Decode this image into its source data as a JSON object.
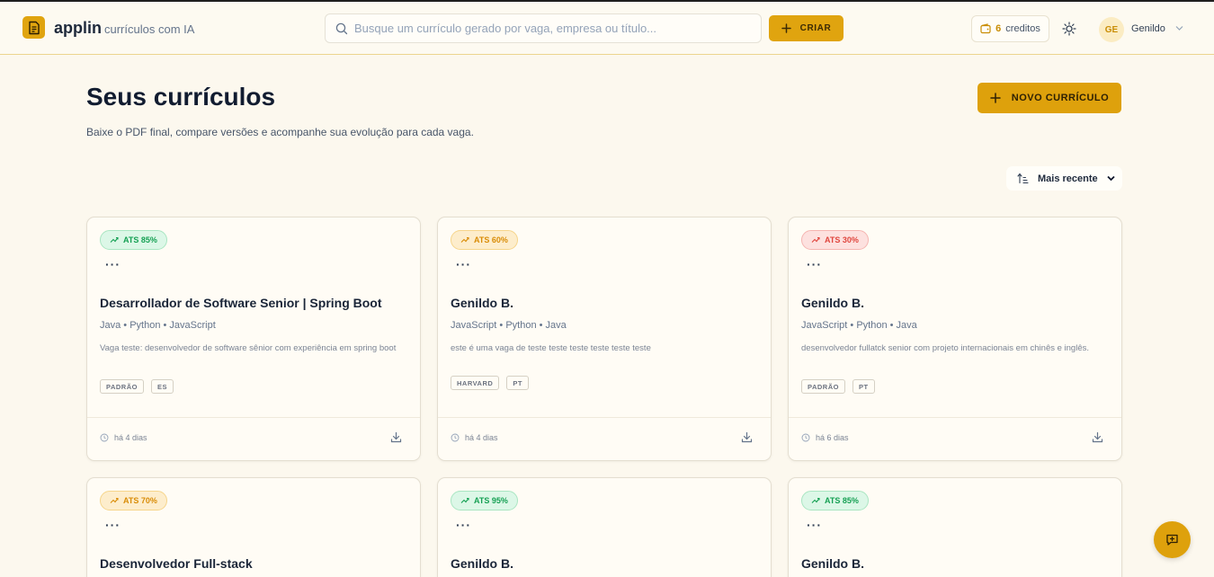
{
  "header": {
    "brand_name": "applin",
    "brand_tagline": "currículos com IA",
    "search_placeholder": "Busque um currículo gerado por vaga, empresa ou título...",
    "create_label": "CRIAR",
    "credits_count": "6",
    "credits_label": "creditos",
    "avatar_initials": "GE",
    "user_name": "Genildo"
  },
  "main": {
    "title": "Seus currículos",
    "subtitle": "Baixe o PDF final, compare versões e acompanhe sua evolução para cada vaga.",
    "new_button_label": "NOVO CURRÍCULO",
    "sort_label": "Mais recente"
  },
  "cards": [
    {
      "ats": "ATS 85%",
      "ats_level": "green",
      "title": "Desarrollador de Software Senior | Spring Boot",
      "skills": "Java • Python • JavaScript",
      "description": "Vaga teste: desenvolvedor de software sênior com experiência em spring boot",
      "tags": [
        "PADRÃO",
        "ES"
      ],
      "time": "há 4 dias"
    },
    {
      "ats": "ATS 60%",
      "ats_level": "amber",
      "title": "Genildo B.",
      "skills": "JavaScript • Python • Java",
      "description": "este é uma vaga de teste teste teste teste teste teste",
      "tags": [
        "HARVARD",
        "PT"
      ],
      "time": "há 4 dias"
    },
    {
      "ats": "ATS 30%",
      "ats_level": "red",
      "title": "Genildo B.",
      "skills": "JavaScript • Python • Java",
      "description": "desenvolvedor fullatck senior com projeto internacionais em chinês e inglês.",
      "tags": [
        "PADRÃO",
        "PT"
      ],
      "time": "há 6 dias"
    },
    {
      "ats": "ATS 70%",
      "ats_level": "amber",
      "title": "Desenvolvedor Full-stack"
    },
    {
      "ats": "ATS 95%",
      "ats_level": "green",
      "title": "Genildo B."
    },
    {
      "ats": "ATS 85%",
      "ats_level": "green",
      "title": "Genildo B."
    }
  ],
  "colors": {
    "accent": "#dea10c",
    "ats_green": "#15a053",
    "ats_amber": "#d98c06",
    "ats_red": "#e0463e"
  },
  "icons": {
    "logo": "document-icon",
    "search": "search-icon",
    "create": "plus-icon",
    "credits": "wallet-icon",
    "theme": "sun-icon",
    "user_menu": "chevron-down-icon",
    "sort": "sort-icon",
    "ats": "trending-up-icon",
    "more": "more-horizontal-icon",
    "time": "clock-icon",
    "download": "download-icon",
    "fab": "chat-plus-icon"
  }
}
